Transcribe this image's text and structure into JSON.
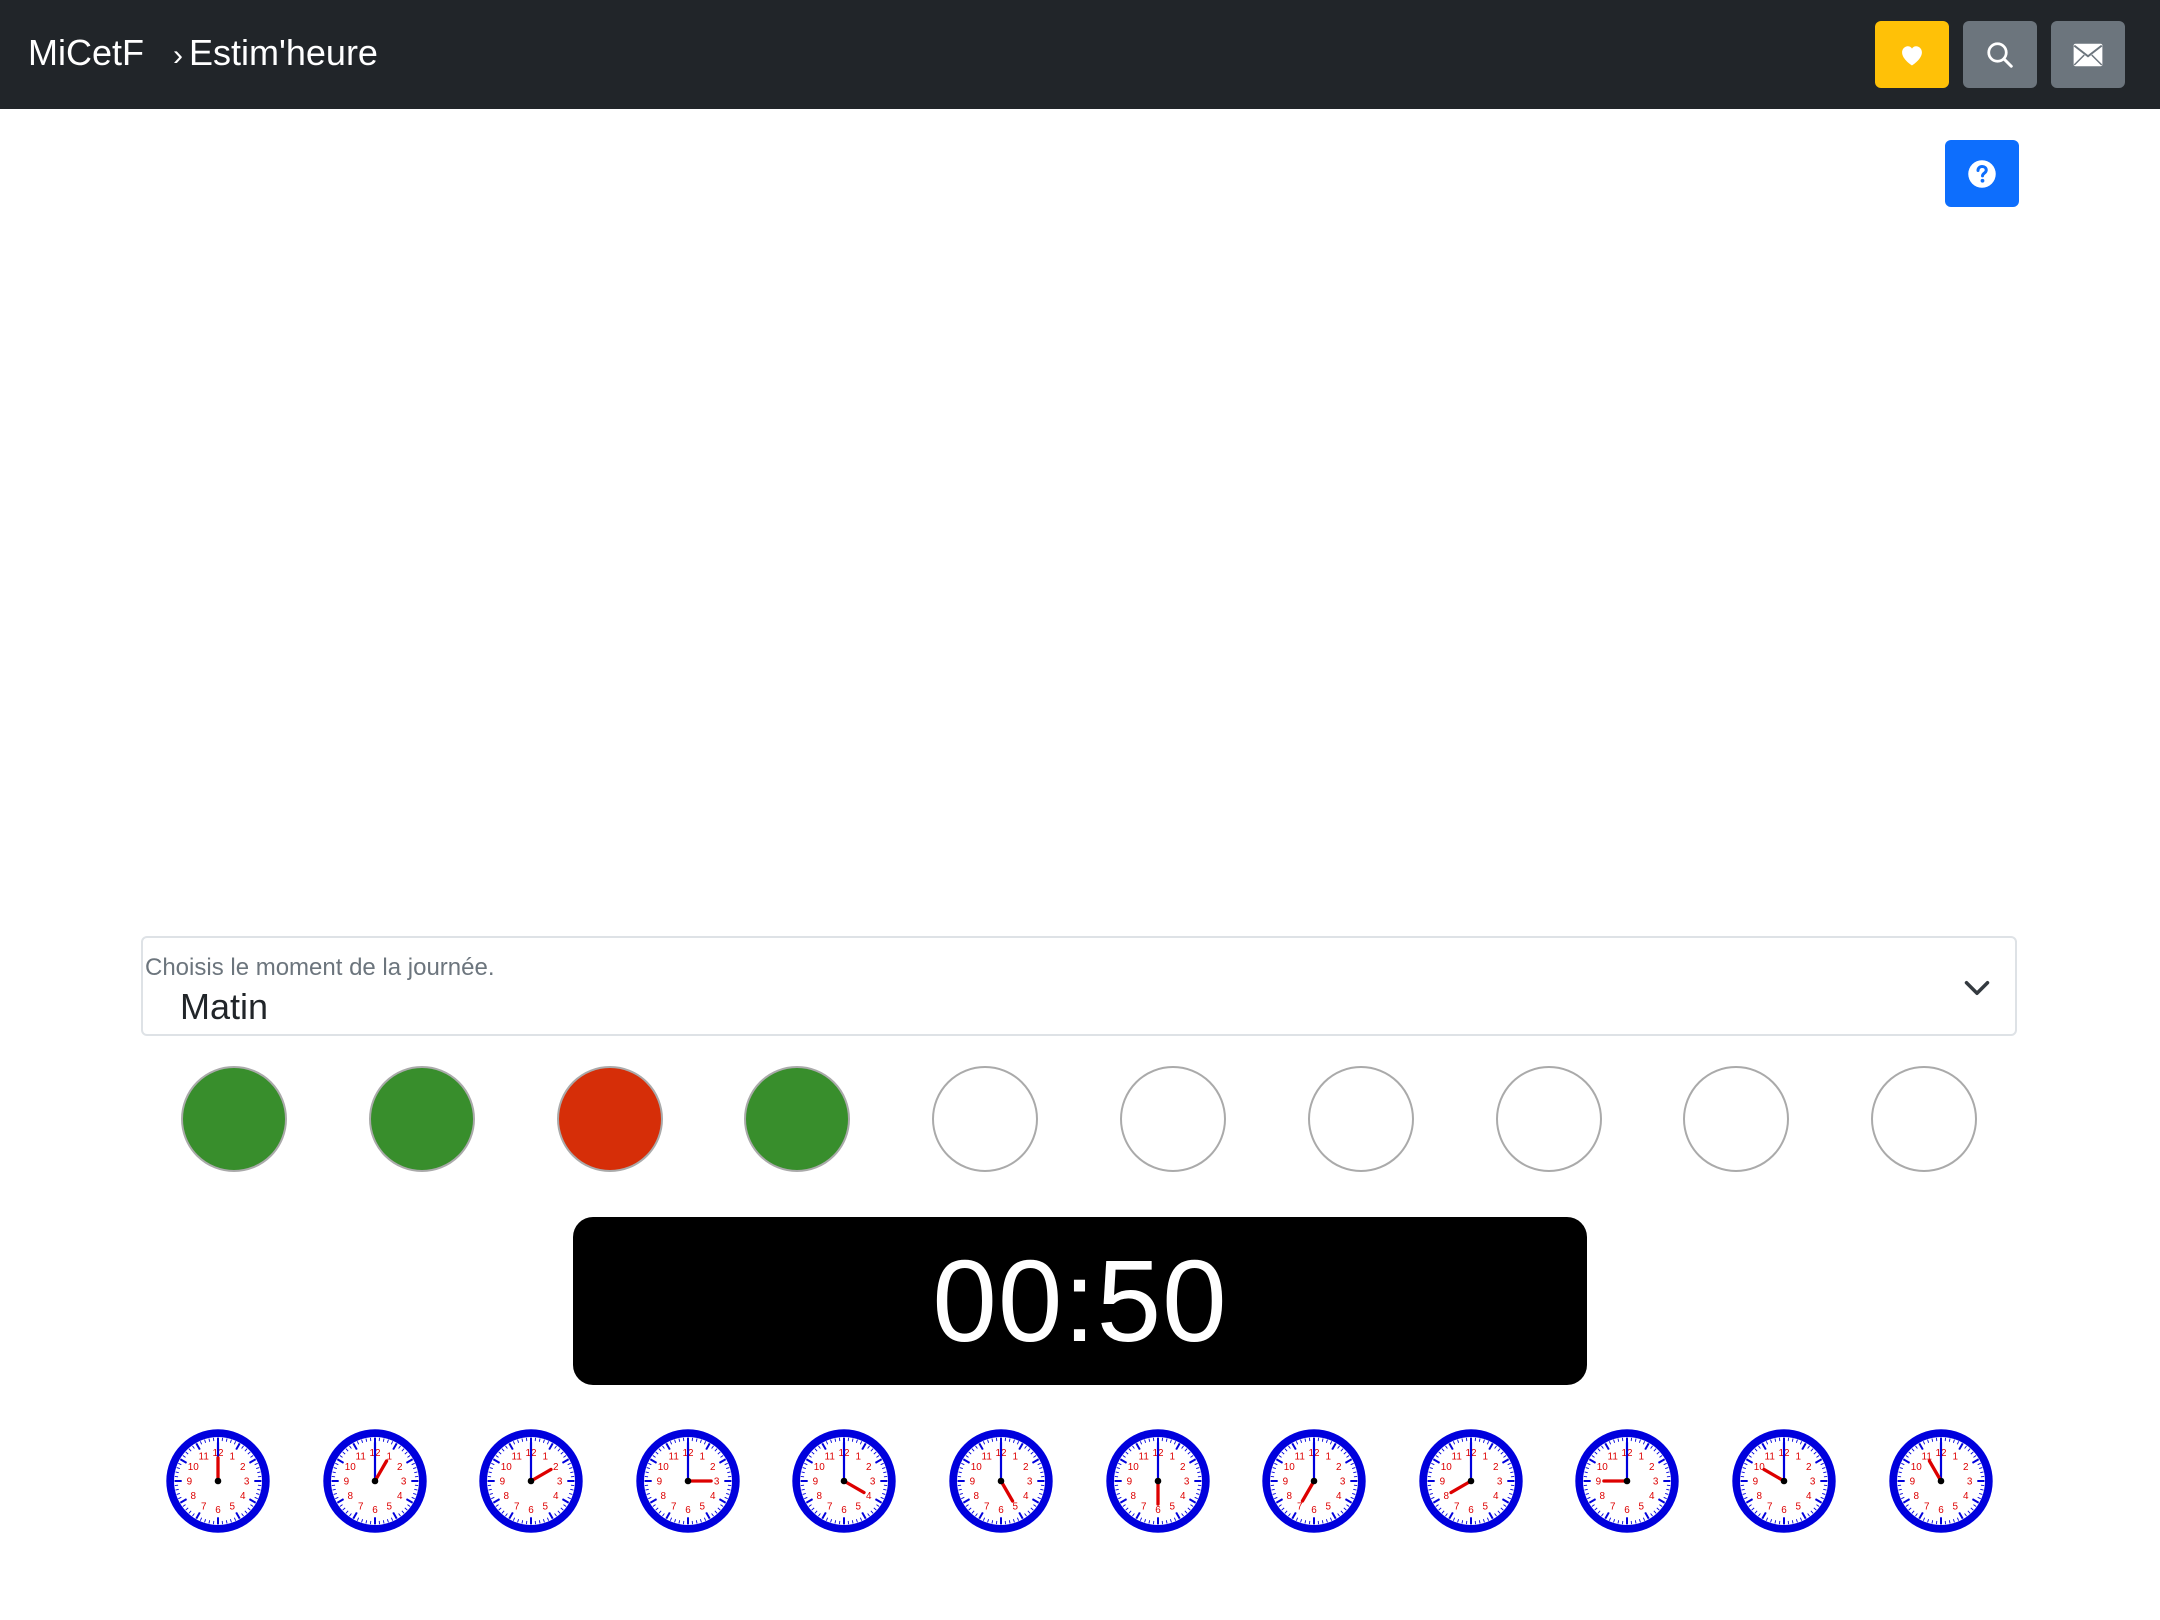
{
  "header": {
    "brand": "MiCetF",
    "crumb_sep": "›",
    "crumb": "Estim'heure",
    "buttons": [
      {
        "name": "favorite-button",
        "icon": "heart-icon",
        "color": "#ffc107"
      },
      {
        "name": "search-button",
        "icon": "search-icon",
        "color": "#6c757d"
      },
      {
        "name": "mail-button",
        "icon": "envelope-icon",
        "color": "#6c757d"
      }
    ]
  },
  "help": {
    "icon": "question-circle-icon",
    "color": "#0d6efd"
  },
  "moment_select": {
    "label": "Choisis le moment de la journée.",
    "value": "Matin"
  },
  "progress": {
    "colors": {
      "correct": "#388e2c",
      "wrong": "#d62e08",
      "pending": "#ffffff"
    },
    "results": [
      "correct",
      "correct",
      "wrong",
      "correct",
      "pending",
      "pending",
      "pending",
      "pending",
      "pending",
      "pending"
    ]
  },
  "timer": {
    "display": "00:50"
  },
  "clocks": {
    "face_color": "#0000dd",
    "number_color": "#dd0000",
    "hours": [
      12,
      1,
      2,
      3,
      4,
      5,
      6,
      7,
      8,
      9,
      10,
      11
    ]
  }
}
